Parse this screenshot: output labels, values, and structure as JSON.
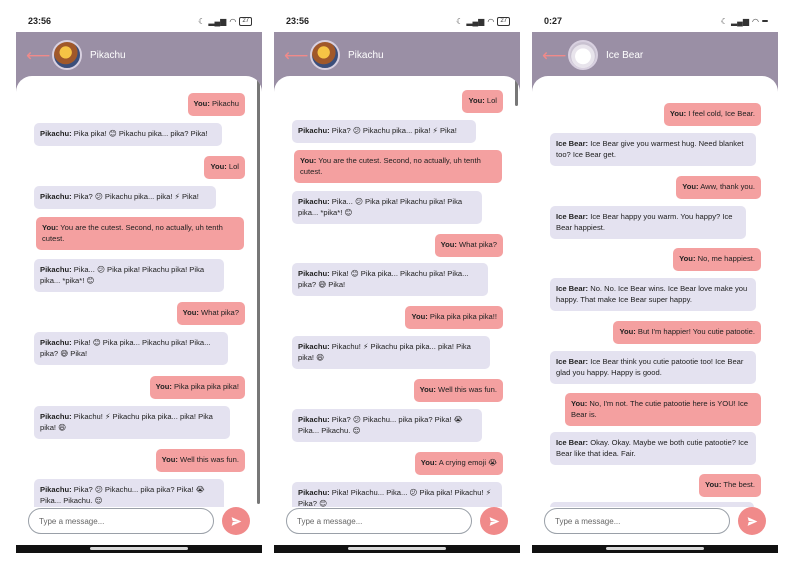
{
  "phones": [
    {
      "status_time": "23:56",
      "battery": "27",
      "contact_name": "Pikachu",
      "input_placeholder": "Type a message...",
      "messages": [
        {
          "from": "me",
          "sender": "You:",
          "text": " Pikachu"
        },
        {
          "from": "bot",
          "sender": "Pikachu:",
          "text": " Pika pika! 😊 Pikachu pika... pika? Pika!"
        },
        {
          "from": "me",
          "sender": "You:",
          "text": " Lol"
        },
        {
          "from": "bot",
          "sender": "Pikachu:",
          "text": " Pika? 😕 Pikachu pika... pika! ⚡ Pika!"
        },
        {
          "from": "me",
          "sender": "You:",
          "text": " You are the cutest. Second, no actually, uh tenth cutest."
        },
        {
          "from": "bot",
          "sender": "Pikachu:",
          "text": " Pika... 😕 Pika pika! Pikachu pika! Pika pika... *pika*! 😊"
        },
        {
          "from": "me",
          "sender": "You:",
          "text": " What pika?"
        },
        {
          "from": "bot",
          "sender": "Pikachu:",
          "text": " Pika! 😊 Pika pika... Pikachu pika! Pika... pika? 😅 Pika!"
        },
        {
          "from": "me",
          "sender": "You:",
          "text": " Pika pika pika pika!"
        },
        {
          "from": "bot",
          "sender": "Pikachu:",
          "text": " Pikachu! ⚡ Pikachu pika pika... pika! Pika pika! 😄"
        },
        {
          "from": "me",
          "sender": "You:",
          "text": " Well this was fun."
        },
        {
          "from": "bot",
          "sender": "Pikachu:",
          "text": " Pika? 😕 Pikachu... pika pika? Pika! 😭 Pika... Pikachu. 😌"
        }
      ]
    },
    {
      "status_time": "23:56",
      "battery": "27",
      "contact_name": "Pikachu",
      "input_placeholder": "Type a message...",
      "messages": [
        {
          "from": "me",
          "sender": "You:",
          "text": " Lol"
        },
        {
          "from": "bot",
          "sender": "Pikachu:",
          "text": " Pika? 😕 Pikachu pika... pika! ⚡ Pika!"
        },
        {
          "from": "me",
          "sender": "You:",
          "text": " You are the cutest. Second, no actually, uh tenth cutest."
        },
        {
          "from": "bot",
          "sender": "Pikachu:",
          "text": " Pika... 😕 Pika pika! Pikachu pika! Pika pika... *pika*! 😊"
        },
        {
          "from": "me",
          "sender": "You:",
          "text": " What pika?"
        },
        {
          "from": "bot",
          "sender": "Pikachu:",
          "text": " Pika! 😊 Pika pika... Pikachu pika! Pika... pika? 😅 Pika!"
        },
        {
          "from": "me",
          "sender": "You:",
          "text": " Pika pika pika pika!!"
        },
        {
          "from": "bot",
          "sender": "Pikachu:",
          "text": " Pikachu! ⚡ Pikachu pika pika... pika! Pika pika! 😄"
        },
        {
          "from": "me",
          "sender": "You:",
          "text": " Well this was fun."
        },
        {
          "from": "bot",
          "sender": "Pikachu:",
          "text": " Pika? 😕 Pikachu... pika pika? Pika! 😭 Pika... Pikachu. 😌"
        },
        {
          "from": "me",
          "sender": "You:",
          "text": " A crying emoji 😭"
        },
        {
          "from": "bot",
          "sender": "Pikachu:",
          "text": " Pika! Pikachu... Pika... 😕 Pika pika! Pikachu! ⚡ Pika? 😊"
        }
      ]
    },
    {
      "status_time": "0:27",
      "battery": "",
      "contact_name": "Ice Bear",
      "input_placeholder": "Type a message...",
      "messages": [
        {
          "from": "me",
          "sender": "You:",
          "text": " I feel cold, Ice Bear."
        },
        {
          "from": "bot",
          "sender": "Ice Bear:",
          "text": " Ice Bear give you warmest hug. Need blanket too? Ice Bear get."
        },
        {
          "from": "me",
          "sender": "You:",
          "text": " Aww, thank you."
        },
        {
          "from": "bot",
          "sender": "Ice Bear:",
          "text": " Ice Bear happy you warm. You happy? Ice Bear happiest."
        },
        {
          "from": "me",
          "sender": "You:",
          "text": " No, me happiest."
        },
        {
          "from": "bot",
          "sender": "Ice Bear:",
          "text": " No. No. Ice Bear wins. Ice Bear love make you happy. That make Ice Bear super happy."
        },
        {
          "from": "me",
          "sender": "You:",
          "text": " But I'm happier! You cutie patootie."
        },
        {
          "from": "bot",
          "sender": "Ice Bear:",
          "text": " Ice Bear think you cutie patootie too! Ice Bear glad you happy. Happy is good."
        },
        {
          "from": "me",
          "sender": "You:",
          "text": " No, I'm not. The cutie patootie here is YOU! Ice Bear is."
        },
        {
          "from": "bot",
          "sender": "Ice Bear:",
          "text": " Okay. Okay. Maybe we both cutie patootie? Ice Bear like that idea. Fair."
        },
        {
          "from": "me",
          "sender": "You:",
          "text": " The best."
        },
        {
          "from": "bot",
          "sender": "",
          "text": ""
        }
      ]
    }
  ]
}
